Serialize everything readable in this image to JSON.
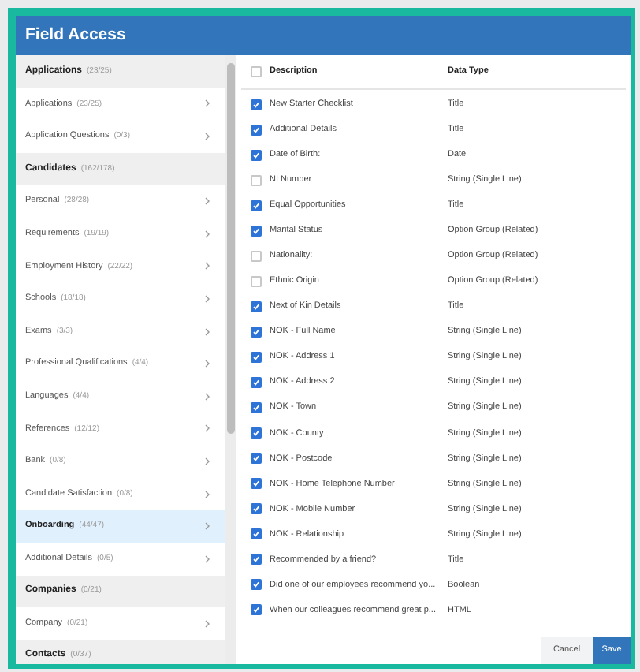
{
  "window": {
    "title": "Field Access"
  },
  "sidebar": {
    "items": [
      {
        "kind": "section",
        "label": "Applications",
        "count": "(23/25)",
        "selected": false
      },
      {
        "kind": "item",
        "label": "Applications",
        "count": "(23/25)",
        "selected": false
      },
      {
        "kind": "item",
        "label": "Application Questions",
        "count": "(0/3)",
        "selected": false
      },
      {
        "kind": "section",
        "label": "Candidates",
        "count": "(162/178)",
        "selected": false
      },
      {
        "kind": "item",
        "label": "Personal",
        "count": "(28/28)",
        "selected": false
      },
      {
        "kind": "item",
        "label": "Requirements",
        "count": "(19/19)",
        "selected": false
      },
      {
        "kind": "item",
        "label": "Employment History",
        "count": "(22/22)",
        "selected": false
      },
      {
        "kind": "item",
        "label": "Schools",
        "count": "(18/18)",
        "selected": false
      },
      {
        "kind": "item",
        "label": "Exams",
        "count": "(3/3)",
        "selected": false
      },
      {
        "kind": "item",
        "label": "Professional Qualifications",
        "count": "(4/4)",
        "selected": false
      },
      {
        "kind": "item",
        "label": "Languages",
        "count": "(4/4)",
        "selected": false
      },
      {
        "kind": "item",
        "label": "References",
        "count": "(12/12)",
        "selected": false
      },
      {
        "kind": "item",
        "label": "Bank",
        "count": "(0/8)",
        "selected": false
      },
      {
        "kind": "item",
        "label": "Candidate Satisfaction",
        "count": "(0/8)",
        "selected": false
      },
      {
        "kind": "item",
        "label": "Onboarding",
        "count": "(44/47)",
        "selected": true
      },
      {
        "kind": "item",
        "label": "Additional Details",
        "count": "(0/5)",
        "selected": false
      },
      {
        "kind": "section",
        "label": "Companies",
        "count": "(0/21)",
        "selected": false
      },
      {
        "kind": "item",
        "label": "Company",
        "count": "(0/21)",
        "selected": false
      },
      {
        "kind": "section",
        "label": "Contacts",
        "count": "(0/37)",
        "selected": false
      }
    ]
  },
  "table": {
    "select_all_checked": false,
    "columns": [
      "Description",
      "Data Type"
    ],
    "rows": [
      {
        "description": "New Starter Checklist",
        "data_type": "Title",
        "checked": true
      },
      {
        "description": "Additional Details",
        "data_type": "Title",
        "checked": true
      },
      {
        "description": "Date of Birth:",
        "data_type": "Date",
        "checked": true
      },
      {
        "description": "NI Number",
        "data_type": "String (Single Line)",
        "checked": false
      },
      {
        "description": "Equal Opportunities",
        "data_type": "Title",
        "checked": true
      },
      {
        "description": "Marital Status",
        "data_type": "Option Group (Related)",
        "checked": true
      },
      {
        "description": "Nationality:",
        "data_type": "Option Group (Related)",
        "checked": false
      },
      {
        "description": "Ethnic Origin",
        "data_type": "Option Group (Related)",
        "checked": false
      },
      {
        "description": "Next of Kin Details",
        "data_type": "Title",
        "checked": true
      },
      {
        "description": "NOK - Full Name",
        "data_type": "String (Single Line)",
        "checked": true
      },
      {
        "description": "NOK - Address 1",
        "data_type": "String (Single Line)",
        "checked": true
      },
      {
        "description": "NOK - Address 2",
        "data_type": "String (Single Line)",
        "checked": true
      },
      {
        "description": "NOK - Town",
        "data_type": "String (Single Line)",
        "checked": true
      },
      {
        "description": "NOK - County",
        "data_type": "String (Single Line)",
        "checked": true
      },
      {
        "description": "NOK - Postcode",
        "data_type": "String (Single Line)",
        "checked": true
      },
      {
        "description": "NOK - Home Telephone Number",
        "data_type": "String (Single Line)",
        "checked": true
      },
      {
        "description": "NOK - Mobile Number",
        "data_type": "String (Single Line)",
        "checked": true
      },
      {
        "description": "NOK - Relationship",
        "data_type": "String (Single Line)",
        "checked": true
      },
      {
        "description": "Recommended by a friend?",
        "data_type": "Title",
        "checked": true
      },
      {
        "description": "Did one of our employees recommend yo...",
        "data_type": "Boolean",
        "checked": true
      },
      {
        "description": "When our colleagues recommend great p...",
        "data_type": "HTML",
        "checked": true
      }
    ]
  },
  "buttons": [
    {
      "label": "Cancel",
      "kind": "secondary"
    },
    {
      "label": "Save",
      "kind": "primary"
    }
  ]
}
